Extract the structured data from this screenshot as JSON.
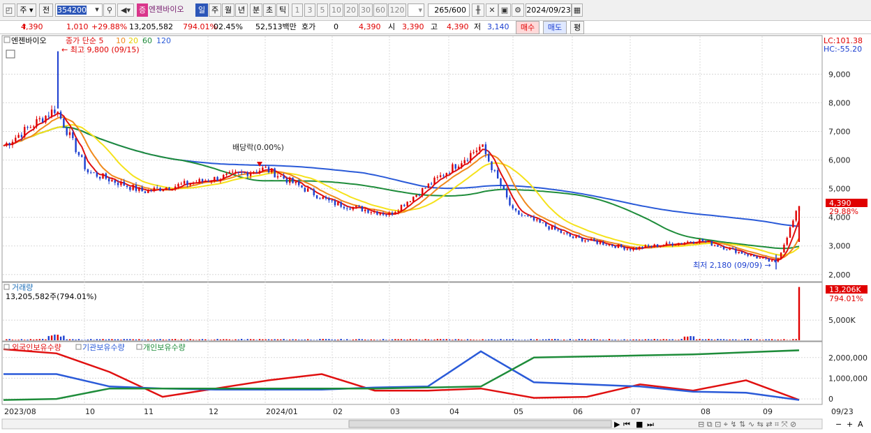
{
  "toolbar": {
    "market_label": "주",
    "type_label": "전",
    "code_value": "354200",
    "name_badge": "증",
    "stock_name": "엔젠바이오",
    "period_buttons": [
      "일",
      "주",
      "월",
      "년",
      "분",
      "초",
      "틱"
    ],
    "active_period": "일",
    "interval_buttons": [
      "1",
      "3",
      "5",
      "10",
      "20",
      "30",
      "60",
      "120"
    ],
    "count_value": "265",
    "count_total": "/600",
    "date_value": "2024/09/23"
  },
  "quote": {
    "price": "4,390",
    "change": "1,010",
    "change_pct": "+29.88%",
    "volume": "13,205,582",
    "volume_ratio": "794.01%",
    "turnover": "02.45%",
    "amount": "52,513백만",
    "hoga_label": "호가",
    "hoga_value": "0",
    "cur_value": "4,390",
    "open_label": "시",
    "open_value": "3,390",
    "high_label": "고",
    "high_value": "4,390",
    "low_label": "저",
    "low_value": "3,140",
    "buy_label": "매수",
    "sell_label": "매도",
    "avg_label": "평"
  },
  "colors": {
    "up": "#e00000",
    "down": "#1c3fd0",
    "ma5": "#e01010",
    "ma10": "#f08a1c",
    "ma20": "#f5e21a",
    "ma60": "#1e8c3a",
    "ma120": "#2a5ad8",
    "foreign": "#e01010",
    "inst": "#2a5ad8",
    "indiv": "#1e8c3a"
  },
  "chart_data": [
    {
      "type": "candlestick",
      "legend": {
        "name": "엔젠바이오",
        "prefix": "종가 단순",
        "ma_periods": [
          "5",
          "10",
          "20",
          "60",
          "120"
        ]
      },
      "y_ticks": [
        "9,000",
        "8,000",
        "7,000",
        "6,000",
        "5,000",
        "4,000",
        "3,000",
        "2,000"
      ],
      "y_tick_values": [
        9000,
        8000,
        7000,
        6000,
        5000,
        4000,
        3000,
        2000
      ],
      "ylim": [
        1800,
        10300
      ],
      "lc_label": "LC:101.38",
      "hc_label": "HC:-55.20",
      "high_annotation": "최고 9,800 (09/15)",
      "low_annotation": "최저 2,180 (09/09)",
      "dividend_annotation": "배당락(0.00%)",
      "last_price_badge": "4,390",
      "last_change_badge": "29.88%",
      "key_points": [
        {
          "date": "2023/08",
          "close": 6500
        },
        {
          "date": "2023/09/15",
          "close": 7800,
          "high": 9800
        },
        {
          "date": "2023/10",
          "close": 5600
        },
        {
          "date": "2023/11",
          "close": 4900
        },
        {
          "date": "2023/12",
          "close": 5300
        },
        {
          "date": "2024/01",
          "close": 5700
        },
        {
          "date": "2024/02",
          "close": 4500
        },
        {
          "date": "2024/03",
          "close": 4100
        },
        {
          "date": "2024/04",
          "close": 6500
        },
        {
          "date": "2024/05",
          "close": 4200
        },
        {
          "date": "2024/06",
          "close": 3300
        },
        {
          "date": "2024/07",
          "close": 2900
        },
        {
          "date": "2024/08",
          "close": 3200
        },
        {
          "date": "2024/09/09",
          "close": 2400,
          "low": 2180
        },
        {
          "date": "2024/09/23",
          "close": 4390
        }
      ]
    },
    {
      "type": "bar",
      "title": "거래량",
      "value_label": "13,205,582주(794.01%)",
      "y_ticks": [
        "5,000K"
      ],
      "y_tick_values": [
        5000
      ],
      "ylim": [
        0,
        14000
      ],
      "last_badge": "13,206K",
      "last_ratio_badge": "794.01%",
      "peak_volumes_k": [
        {
          "date": "2023/09/15",
          "volume": 1600
        },
        {
          "date": "2024/08",
          "volume": 1200
        },
        {
          "date": "2024/09/23",
          "volume": 13206
        }
      ]
    },
    {
      "type": "line",
      "legend": [
        "외국인보유수량",
        "기관보유수량",
        "개인보유수량"
      ],
      "y_ticks": [
        "2,000,000",
        "1,000,000",
        "0"
      ],
      "y_tick_values": [
        2000000,
        1000000,
        0
      ],
      "ylim": [
        -200000,
        2700000
      ],
      "series": [
        {
          "name": "외국인보유수량",
          "values": [
            2400000,
            2200000,
            1300000,
            100000,
            500000,
            900000,
            1200000,
            400000,
            400000,
            500000,
            50000,
            100000,
            700000,
            400000,
            900000,
            -50000
          ]
        },
        {
          "name": "기관보유수량",
          "values": [
            1200000,
            1200000,
            600000,
            500000,
            450000,
            450000,
            450000,
            550000,
            600000,
            2300000,
            800000,
            700000,
            600000,
            350000,
            300000,
            -50000
          ]
        },
        {
          "name": "개인보유수량",
          "values": [
            -50000,
            0,
            500000,
            500000,
            500000,
            500000,
            500000,
            500000,
            550000,
            600000,
            2000000,
            2050000,
            2100000,
            2150000,
            2250000,
            2350000
          ]
        }
      ]
    }
  ],
  "x_axis": {
    "labels": [
      "2023/08",
      "10",
      "11",
      "12",
      "2024/01",
      "02",
      "03",
      "04",
      "05",
      "06",
      "07",
      "08",
      "09",
      "09/23"
    ]
  }
}
